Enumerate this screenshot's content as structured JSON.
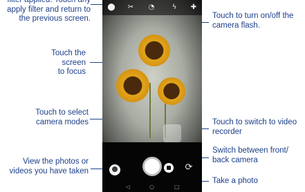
{
  "annotations": {
    "filter_applied": "filter applied. Touch any\napply filter and return to\nthe previous screen.",
    "flash": "Touch to turn on/off the\ncamera flash.",
    "focus": "Touch the screen\nto focus",
    "modes": "Touch to select\ncamera modes",
    "gallery": "View the photos or\nvideos you have taken",
    "video": "Touch to switch to video\nrecorder",
    "switch_camera": "Switch between front/\nback camera",
    "take_photo": "Take a photo"
  },
  "colors": {
    "annotation_text": "#1d3f8a",
    "phone_bg": "#0b0b0b",
    "sunflower_petal": "#e3a51a",
    "sunflower_center": "#4a2a0c"
  },
  "icons": {
    "topbar": [
      "filter-icon",
      "hdr-icon",
      "timer-icon",
      "flash-icon",
      "settings-icon"
    ],
    "bottom": [
      "gallery-icon",
      "shutter-button",
      "video-icon",
      "switch-camera-icon"
    ],
    "nav": [
      "back-icon",
      "home-icon",
      "recents-icon"
    ]
  }
}
